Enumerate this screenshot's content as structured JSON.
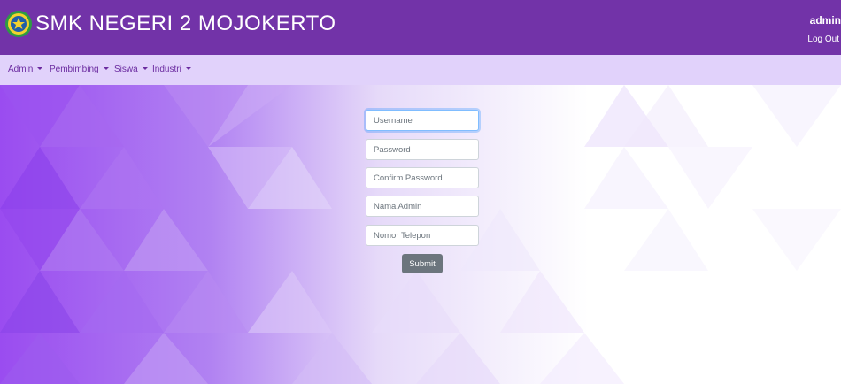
{
  "header": {
    "title": "SMK NEGERI 2 MOJOKERTO",
    "user": "admin",
    "logout_label": "Log Out"
  },
  "nav": {
    "items": [
      {
        "label": "Admin"
      },
      {
        "label": "Pembimbing"
      },
      {
        "label": "Siswa"
      },
      {
        "label": "Industri"
      }
    ]
  },
  "form": {
    "username_placeholder": "Username",
    "password_placeholder": "Password",
    "confirm_password_placeholder": "Confirm Password",
    "nama_admin_placeholder": "Nama Admin",
    "nomor_telepon_placeholder": "Nomor Telepon",
    "submit_label": "Submit"
  },
  "colors": {
    "header": "#7233a8",
    "nav": "#e1d2fb",
    "nav_text": "#6b2ba0",
    "button": "#6c757d"
  }
}
